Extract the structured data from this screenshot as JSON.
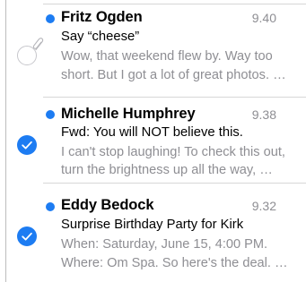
{
  "accent_color": "#1d7cf2",
  "messages": [
    {
      "sender": "Fritz Ogden",
      "time": "9.40",
      "subject": "Say “cheese”",
      "preview_line1": "Wow, that weekend flew by. Way too",
      "preview_line2": "short. But I got a lot of great photos. …",
      "selected": false,
      "unread": true,
      "has_attachment": true
    },
    {
      "sender": "Michelle Humphrey",
      "time": "9.38",
      "subject": "Fwd: You will NOT believe this.",
      "preview_line1": "I can't stop laughing! To check this out,",
      "preview_line2": "turn the brightness up all the way, …",
      "selected": true,
      "unread": true,
      "has_attachment": false
    },
    {
      "sender": "Eddy Bedock",
      "time": "9.32",
      "subject": "Surprise Birthday Party for Kirk",
      "preview_line1": "When: Saturday, June 15, 4:00 PM.",
      "preview_line2": "Where: Om Spa. So here's the deal. …",
      "selected": true,
      "unread": true,
      "has_attachment": false
    }
  ],
  "icons": {
    "unselected": "empty-circle",
    "selected": "checkmark-circle",
    "attachment": "paperclip",
    "unread": "blue-dot"
  }
}
